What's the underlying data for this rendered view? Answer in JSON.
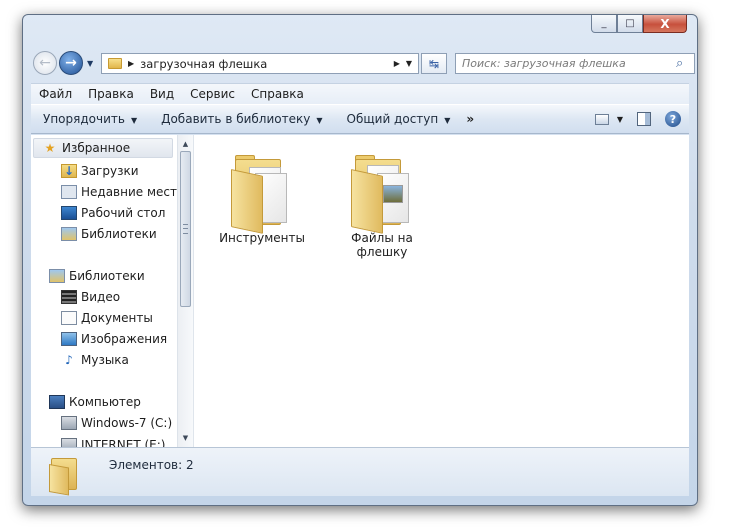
{
  "caption": {
    "minimize_glyph": "_",
    "maximize_glyph": "□",
    "close_glyph": "X"
  },
  "navigation": {
    "back_glyph": "←",
    "forward_glyph": "→",
    "history_dropdown_glyph": "▼"
  },
  "address_bar": {
    "separator_glyph": "▶",
    "path_label": "загрузочная флешка",
    "trailing_glyph": "▶",
    "dropdown_glyph": "▼",
    "refresh_glyph": "↹"
  },
  "search": {
    "placeholder": "Поиск: загрузочная флешка",
    "icon": "magnifier-icon",
    "icon_glyph": "⌕"
  },
  "menu": {
    "items": [
      "Файл",
      "Правка",
      "Вид",
      "Сервис",
      "Справка"
    ]
  },
  "toolbar": {
    "organize": "Упорядочить",
    "add_to_library": "Добавить в библиотеку",
    "share": "Общий доступ",
    "more": "»",
    "dropdown_glyph": "▼",
    "help_glyph": "?"
  },
  "nav_pane": {
    "favorites": {
      "header": "Избранное",
      "items": [
        "Загрузки",
        "Недавние места",
        "Рабочий стол",
        "Библиотеки"
      ]
    },
    "libraries": {
      "header": "Библиотеки",
      "items": [
        "Видео",
        "Документы",
        "Изображения",
        "Музыка"
      ]
    },
    "computer": {
      "header": "Компьютер",
      "items": [
        "Windows-7 (C:)",
        "INTERNET (E:)"
      ]
    },
    "icons": {
      "star": "★",
      "music": "♪"
    }
  },
  "scrollbar": {
    "up_glyph": "▲",
    "down_glyph": "▼"
  },
  "content": {
    "items": [
      {
        "name": "Инструменты",
        "icon": "folder-icon"
      },
      {
        "name": "Файлы на флешку",
        "icon": "folder-with-files-icon"
      }
    ]
  },
  "status": {
    "count_text": "Элементов: 2"
  }
}
